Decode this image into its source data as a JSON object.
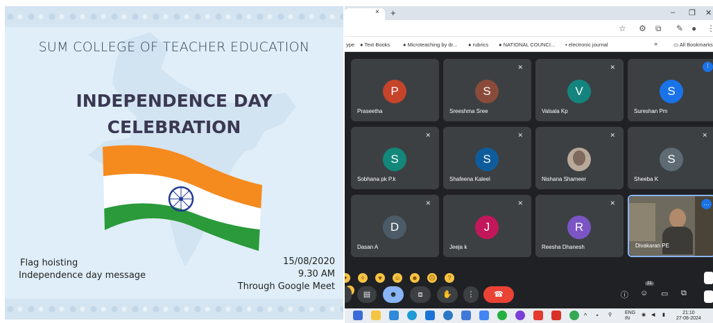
{
  "poster": {
    "college": "SUM COLLEGE OF TEACHER EDUCATION",
    "title_line1": "INDEPENDENCE DAY",
    "title_line2": "CELEBRATION",
    "events": [
      "Flag hoisting",
      "Independence day message"
    ],
    "date": "15/08/2020",
    "time": "9.30 AM",
    "platform": "Through Google Meet"
  },
  "browser": {
    "tab_close": "×",
    "tab_new": "+",
    "bookmarks": [
      "ype",
      "Text Books",
      "Microteaching by dr...",
      "rubrics",
      "NATIONAL COUNCI...",
      "electronic journal",
      "»",
      "All Bookmarks"
    ]
  },
  "meet": {
    "participants": [
      {
        "name": "Praseetha",
        "initial": "P",
        "color": "#c5442a",
        "muted": false
      },
      {
        "name": "Sreeshma Sree",
        "initial": "S",
        "color": "#8a4b3a",
        "muted": true
      },
      {
        "name": "Valsala Kp",
        "initial": "V",
        "color": "#14857e",
        "muted": true
      },
      {
        "name": "Sureshan Pm",
        "initial": "S",
        "color": "#1a73e8",
        "muted": false,
        "speaking": true
      },
      {
        "name": "Sobhana pk P.k",
        "initial": "S",
        "color": "#12877a",
        "muted": true
      },
      {
        "name": "Shafeena Kaleel",
        "initial": "S",
        "color": "#0e5c9c",
        "muted": true
      },
      {
        "name": "Nishana Shameer",
        "initial": "",
        "color": "#b9a99a",
        "muted": true,
        "photo": true
      },
      {
        "name": "Sheeba K",
        "initial": "S",
        "color": "#5f6b73",
        "muted": true
      },
      {
        "name": "Dasan A",
        "initial": "D",
        "color": "#4b5b68",
        "muted": true
      },
      {
        "name": "Jeeja k",
        "initial": "J",
        "color": "#c2185b",
        "muted": true
      },
      {
        "name": "Reesha Dhanesh",
        "initial": "R",
        "color": "#7b55c4",
        "muted": true
      },
      {
        "name": "Divakaran PE",
        "initial": "",
        "color": "#6e6a5e",
        "muted": false,
        "video": true
      }
    ],
    "participant_count": "21"
  },
  "taskbar": {
    "lang1": "ENG",
    "lang2": "IN",
    "time": "21:10",
    "date": "27-08-2024"
  }
}
